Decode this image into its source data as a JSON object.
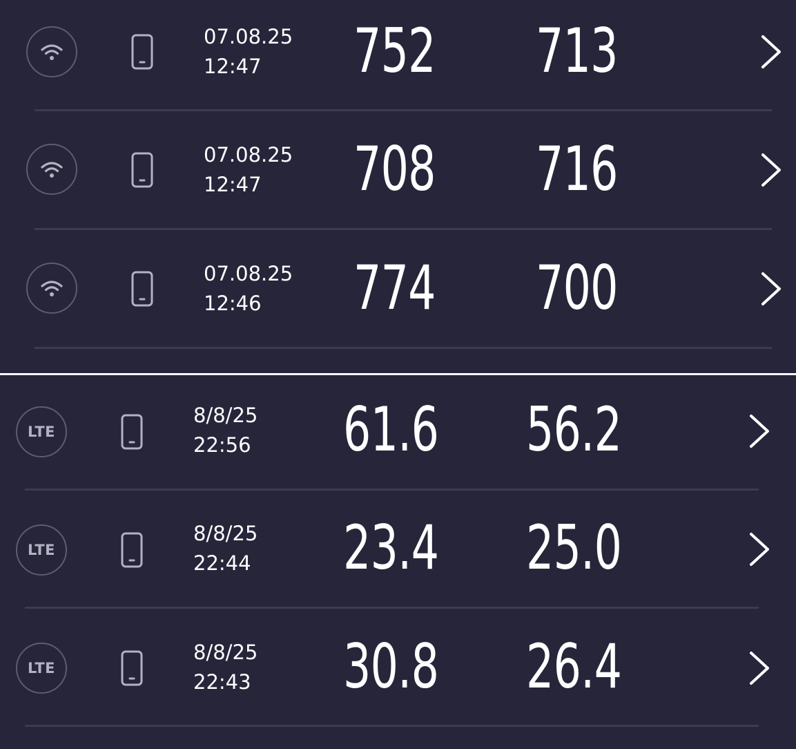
{
  "wifi_results": [
    {
      "network": "wifi-icon",
      "date": "07.08.25",
      "time": "12:47",
      "download": "752",
      "upload": "713"
    },
    {
      "network": "wifi-icon",
      "date": "07.08.25",
      "time": "12:47",
      "download": "708",
      "upload": "716"
    },
    {
      "network": "wifi-icon",
      "date": "07.08.25",
      "time": "12:46",
      "download": "774",
      "upload": "700"
    }
  ],
  "lte_results": [
    {
      "network_label": "LTE",
      "date": "8/8/25",
      "time": "22:56",
      "download": "61.6",
      "upload": "56.2"
    },
    {
      "network_label": "LTE",
      "date": "8/8/25",
      "time": "22:44",
      "download": "23.4",
      "upload": "25.0"
    },
    {
      "network_label": "LTE",
      "date": "8/8/25",
      "time": "22:43",
      "download": "30.8",
      "upload": "26.4"
    }
  ],
  "icons": {
    "device": "smartphone-icon",
    "chevron": "chevron-right-icon"
  },
  "colors": {
    "background": "#26253a",
    "divider": "#3c3b52",
    "icon_ring": "#5d5c72",
    "icon_fill": "#b3b2c2",
    "text": "#ffffff"
  }
}
